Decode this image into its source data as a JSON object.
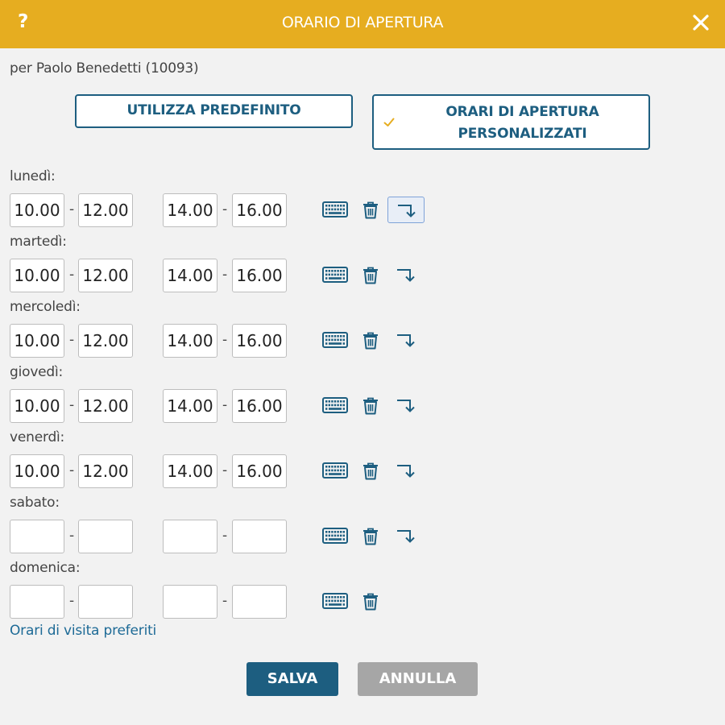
{
  "dialog": {
    "title": "ORARIO DI APERTURA",
    "help_label": "?",
    "subtitle": "per Paolo Benedetti (10093)"
  },
  "options": {
    "default_label": "UTILIZZA PREDEFINITO",
    "custom_label_line1": "ORARI DI APERTURA",
    "custom_label_line2": "PERSONALIZZATI",
    "selected": "custom"
  },
  "days": [
    {
      "label": "lunedì:",
      "slots": [
        "10.00",
        "12.00",
        "14.00",
        "16.00"
      ],
      "copy": true,
      "copy_active": true
    },
    {
      "label": "martedì:",
      "slots": [
        "10.00",
        "12.00",
        "14.00",
        "16.00"
      ],
      "copy": true,
      "copy_active": false
    },
    {
      "label": "mercoledì:",
      "slots": [
        "10.00",
        "12.00",
        "14.00",
        "16.00"
      ],
      "copy": true,
      "copy_active": false
    },
    {
      "label": "giovedì:",
      "slots": [
        "10.00",
        "12.00",
        "14.00",
        "16.00"
      ],
      "copy": true,
      "copy_active": false
    },
    {
      "label": "venerdì:",
      "slots": [
        "10.00",
        "12.00",
        "14.00",
        "16.00"
      ],
      "copy": true,
      "copy_active": false
    },
    {
      "label": "sabato:",
      "slots": [
        "",
        "",
        "",
        ""
      ],
      "copy": true,
      "copy_active": false
    },
    {
      "label": "domenica:",
      "slots": [
        "",
        "",
        "",
        ""
      ],
      "copy": false,
      "copy_active": false
    }
  ],
  "separator": "-",
  "link": {
    "preferred_label": "Orari di visita preferiti"
  },
  "actions": {
    "save_label": "SALVA",
    "cancel_label": "ANNULLA"
  },
  "colors": {
    "header": "#e6ad20",
    "primary": "#1d5e80",
    "check": "#e6ad20",
    "cancel": "#a6a6a6",
    "background": "#f2f2f2"
  },
  "icons": [
    "help-icon",
    "close-icon",
    "check-icon",
    "keyboard-icon",
    "trash-icon",
    "copy-down-icon"
  ]
}
